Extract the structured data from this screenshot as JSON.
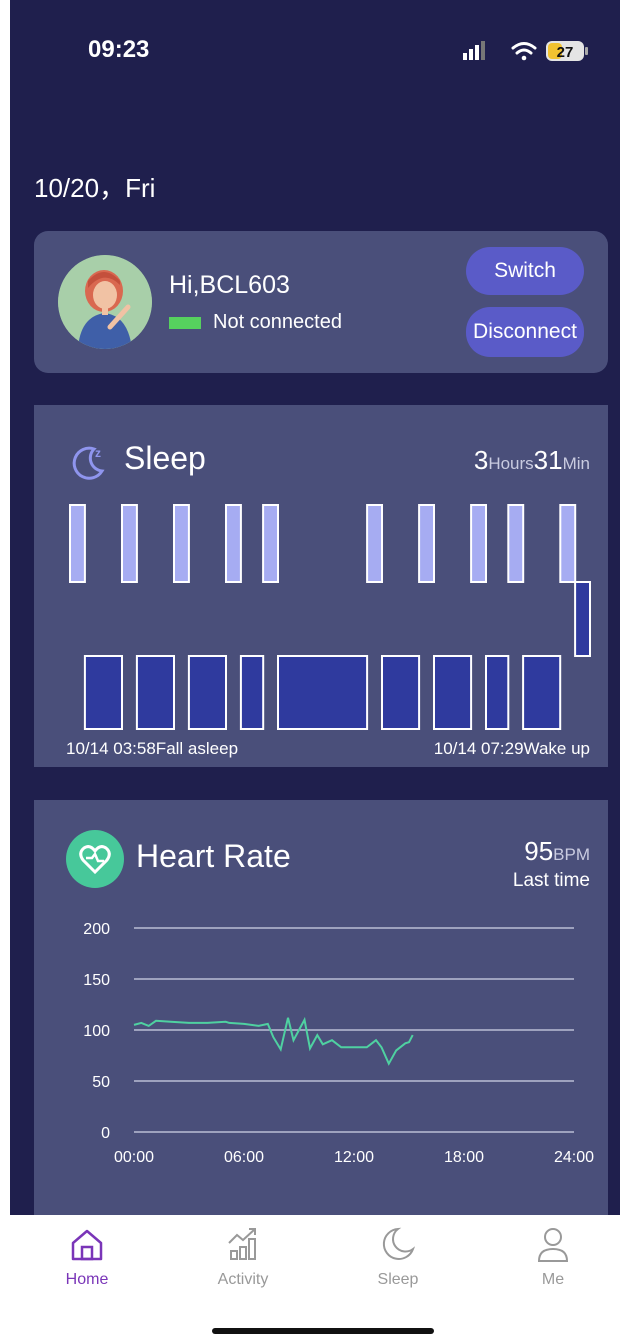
{
  "status_bar": {
    "time": "09:23",
    "battery": "27"
  },
  "date": "10/20，Fri",
  "profile": {
    "greeting": "Hi,BCL603",
    "status": "Not connected",
    "switch_label": "Switch",
    "disconnect_label": "Disconnect"
  },
  "sleep": {
    "title": "Sleep",
    "duration_hours": "3",
    "hours_unit": "Hours",
    "duration_minutes": "31",
    "minutes_unit": "Min",
    "start": "10/14 03:58Fall asleep",
    "end": "10/14 07:29Wake up",
    "segments": [
      {
        "stage": "light",
        "duration": 2
      },
      {
        "stage": "deep",
        "duration": 5
      },
      {
        "stage": "light",
        "duration": 2
      },
      {
        "stage": "deep",
        "duration": 5
      },
      {
        "stage": "light",
        "duration": 2
      },
      {
        "stage": "deep",
        "duration": 5
      },
      {
        "stage": "light",
        "duration": 2
      },
      {
        "stage": "deep",
        "duration": 3
      },
      {
        "stage": "light",
        "duration": 2
      },
      {
        "stage": "deep",
        "duration": 12
      },
      {
        "stage": "light",
        "duration": 2
      },
      {
        "stage": "deep",
        "duration": 5
      },
      {
        "stage": "light",
        "duration": 2
      },
      {
        "stage": "deep",
        "duration": 5
      },
      {
        "stage": "light",
        "duration": 2
      },
      {
        "stage": "deep",
        "duration": 3
      },
      {
        "stage": "light",
        "duration": 2
      },
      {
        "stage": "deep",
        "duration": 5
      },
      {
        "stage": "light",
        "duration": 2
      },
      {
        "stage": "awake",
        "duration": 2
      }
    ]
  },
  "heart_rate": {
    "title": "Heart Rate",
    "value": "95",
    "unit": "BPM",
    "subtitle": "Last time"
  },
  "chart_data": {
    "type": "line",
    "x_ticks": [
      "00:00",
      "06:00",
      "12:00",
      "18:00",
      "24:00"
    ],
    "y_ticks": [
      "200",
      "150",
      "100",
      "50",
      "0"
    ],
    "ylim": [
      0,
      200
    ],
    "xlim": [
      0,
      24
    ],
    "grid": true,
    "series": [
      {
        "color": "#4fd1a1",
        "points": [
          [
            0,
            105
          ],
          [
            0.4,
            107
          ],
          [
            0.8,
            104
          ],
          [
            1.2,
            109
          ],
          [
            2,
            108
          ],
          [
            3,
            107
          ],
          [
            4,
            107
          ],
          [
            5,
            108
          ],
          [
            5.2,
            107
          ],
          [
            6,
            106
          ],
          [
            6.8,
            104
          ],
          [
            7.3,
            106
          ],
          [
            7.6,
            93
          ],
          [
            8,
            81
          ],
          [
            8.4,
            112
          ],
          [
            8.7,
            90
          ],
          [
            9,
            100
          ],
          [
            9.3,
            110
          ],
          [
            9.6,
            82
          ],
          [
            10,
            95
          ],
          [
            10.3,
            86
          ],
          [
            10.8,
            90
          ],
          [
            11.3,
            83
          ],
          [
            12,
            83
          ],
          [
            12.7,
            83
          ],
          [
            13.2,
            90
          ],
          [
            13.5,
            83
          ],
          [
            13.9,
            67
          ],
          [
            14.3,
            80
          ],
          [
            14.8,
            87
          ],
          [
            15,
            88
          ],
          [
            15.2,
            95
          ]
        ]
      }
    ]
  },
  "tabs": [
    {
      "label": "Home",
      "icon": "home-icon",
      "active": true
    },
    {
      "label": "Activity",
      "icon": "activity-icon",
      "active": false
    },
    {
      "label": "Sleep",
      "icon": "moon-icon",
      "active": false
    },
    {
      "label": "Me",
      "icon": "person-icon",
      "active": false
    }
  ],
  "colors": {
    "background": "#1f1f4d",
    "card": "#4a4f7a",
    "accent": "#5a5bc8",
    "light_sleep": "#a6acf2",
    "deep_sleep": "#2f3a9e",
    "heart_line": "#4fd1a1",
    "active_tab": "#7a35b8"
  }
}
